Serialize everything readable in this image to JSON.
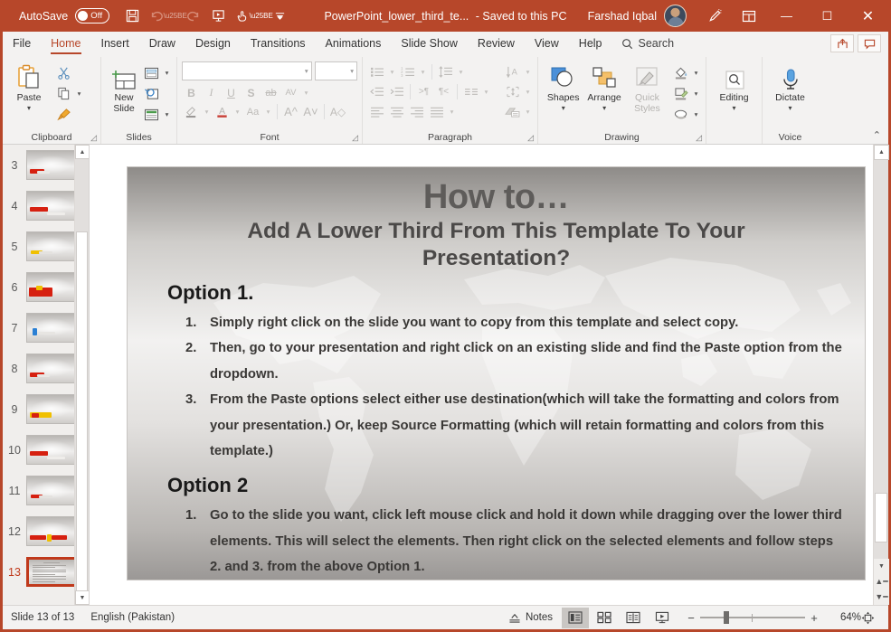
{
  "titlebar": {
    "autosave_label": "AutoSave",
    "autosave_state": "Off",
    "document_title": "PowerPoint_lower_third_te...",
    "save_state": "-  Saved to this PC",
    "user_name": "Farshad Iqbal",
    "qat": [
      {
        "name": "save",
        "glyph": "💾"
      },
      {
        "name": "undo",
        "glyph": "↶"
      },
      {
        "name": "redo",
        "glyph": "↻"
      },
      {
        "name": "start-from-beginning",
        "glyph": "▶"
      },
      {
        "name": "touch-mode",
        "glyph": "☝"
      }
    ],
    "window_buttons": {
      "minimize": "—",
      "maximize": "☐",
      "close": "✕"
    }
  },
  "tabs": [
    {
      "label": "File",
      "active": false
    },
    {
      "label": "Home",
      "active": true
    },
    {
      "label": "Insert",
      "active": false
    },
    {
      "label": "Draw",
      "active": false
    },
    {
      "label": "Design",
      "active": false
    },
    {
      "label": "Transitions",
      "active": false
    },
    {
      "label": "Animations",
      "active": false
    },
    {
      "label": "Slide Show",
      "active": false
    },
    {
      "label": "Review",
      "active": false
    },
    {
      "label": "View",
      "active": false
    },
    {
      "label": "Help",
      "active": false
    }
  ],
  "search": {
    "label": "Search",
    "placeholder": "Search"
  },
  "tabs_right": {
    "share_label": "Share",
    "comments_label": "Comments"
  },
  "ribbon": {
    "groups": [
      {
        "label": "Clipboard",
        "paste_label": "Paste",
        "cut_label": "Cut",
        "copy_label": "Copy",
        "format_painter_label": "Format Painter"
      },
      {
        "label": "Slides",
        "new_slide_label": "New Slide",
        "layout_label": "Layout",
        "reset_label": "Reset",
        "section_label": "Section"
      },
      {
        "label": "Font",
        "font_name_value": "",
        "font_size_value": "",
        "buttons": [
          "B",
          "I",
          "U",
          "S",
          "ab",
          "AV"
        ],
        "row2": [
          "Text Highlight Color",
          "Font Color",
          "Change Case",
          "Increase Font Size",
          "Decrease Font Size",
          "Clear All Formatting"
        ]
      },
      {
        "label": "Paragraph"
      },
      {
        "label": "Drawing",
        "shapes_label": "Shapes",
        "arrange_label": "Arrange",
        "quick_styles_label": "Quick Styles"
      },
      {
        "label": "",
        "editing_label": "Editing"
      },
      {
        "label": "Voice",
        "dictate_label": "Dictate"
      }
    ],
    "collapse_glyph": "⌃"
  },
  "thumbnails": {
    "items": [
      {
        "number": "3",
        "selected": false,
        "accent": "#d62010",
        "style": "bar-left"
      },
      {
        "number": "4",
        "selected": false,
        "accent": "#d62010",
        "style": "bar-wide"
      },
      {
        "number": "5",
        "selected": false,
        "accent": "#f0c000",
        "style": "bar-small"
      },
      {
        "number": "6",
        "selected": false,
        "accent": "#d62010",
        "style": "bar-big"
      },
      {
        "number": "7",
        "selected": false,
        "accent": "#2a7fd4",
        "style": "bar-blue"
      },
      {
        "number": "8",
        "selected": false,
        "accent": "#d62010",
        "style": "bar-left"
      },
      {
        "number": "9",
        "selected": false,
        "accent": "#f0c000",
        "style": "bar-yellow"
      },
      {
        "number": "10",
        "selected": false,
        "accent": "#d62010",
        "style": "bar-wide"
      },
      {
        "number": "11",
        "selected": false,
        "accent": "#d62010",
        "style": "bar-small"
      },
      {
        "number": "12",
        "selected": false,
        "accent": "#d62010",
        "style": "bar-split"
      },
      {
        "number": "13",
        "selected": true,
        "accent": "#c0391b",
        "style": "text"
      }
    ],
    "scroll_up_glyph": "▲",
    "scroll_down_glyph": "▼"
  },
  "slide": {
    "title_line1": "How to…",
    "title_line2": "Add A Lower Third From This Template To Your Presentation?",
    "option1_heading": "Option 1.",
    "option1_steps": [
      {
        "n": "1.",
        "text": "Simply right click on the slide you want to copy from this template and select copy."
      },
      {
        "n": "2.",
        "text": "Then, go to your presentation and right click on an existing slide and find the Paste option from the dropdown."
      },
      {
        "n": "3.",
        "text": "From the Paste options select either use destination(which will take the formatting and colors from your presentation.)  Or, keep Source Formatting (which will retain formatting and colors from this template.)"
      }
    ],
    "option2_heading": "Option 2",
    "option2_steps": [
      {
        "n": "1.",
        "text": "Go to the slide you want, click left mouse click and hold it down while dragging over the lower third elements.  This will select the elements.  Then right click on the selected elements and follow steps 2. and 3. from the above Option 1."
      }
    ]
  },
  "canvas_scrollbar": {
    "up_glyph": "▲",
    "down_glyph": "▼",
    "prev_slide_glyph": "▲",
    "next_slide_glyph": "▼"
  },
  "statusbar": {
    "slide_indicator": "Slide 13 of 13",
    "language": "English (Pakistan)",
    "notes_label": "Notes",
    "views": [
      {
        "name": "normal-view",
        "glyph": "▤",
        "active": true
      },
      {
        "name": "slide-sorter-view",
        "glyph": "☰",
        "active": false
      },
      {
        "name": "reading-view",
        "glyph": "📖",
        "active": false
      },
      {
        "name": "slide-show-view",
        "glyph": "⊞",
        "active": false
      }
    ],
    "zoom_out_glyph": "−",
    "zoom_in_glyph": "+",
    "zoom_percent": "64%",
    "fit_glyph": "⬌"
  },
  "colors": {
    "brand": "#b7472a",
    "accent_selected": "#c0391b",
    "ribbon_bg": "#f3f2f1"
  }
}
